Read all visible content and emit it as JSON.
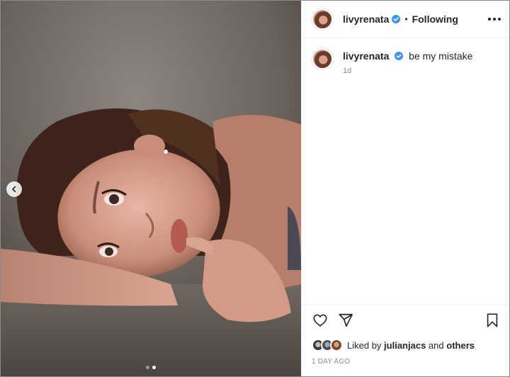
{
  "post": {
    "username": "livyrenata",
    "separator": "•",
    "follow_status": "Following",
    "caption_text": "be my mistake",
    "caption_time": "1d",
    "liked_by_prefix": "Liked by",
    "liked_by_user": "julianjacs",
    "liked_by_and": "and",
    "liked_by_others": "others",
    "date": "1 DAY AGO"
  },
  "carousel": {
    "total_slides": 2,
    "active_slide": 2
  },
  "colors": {
    "verified": "#3897f0",
    "text": "#262626",
    "muted": "#8e8e8e"
  },
  "icons": {
    "more": "more-options-icon",
    "like": "heart-icon",
    "share": "paper-plane-icon",
    "save": "bookmark-icon",
    "prev": "chevron-left-icon",
    "verified": "verified-badge-icon"
  }
}
